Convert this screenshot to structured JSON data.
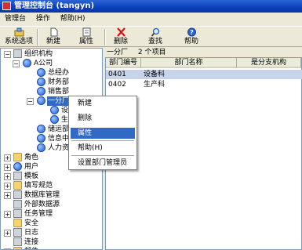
{
  "window": {
    "title": "管理控制台 (tangyn)"
  },
  "menubar": [
    "管理台",
    "操作",
    "帮助(H)"
  ],
  "toolbar": {
    "buttons": [
      {
        "label": "系统选项",
        "icon": "system-options-icon"
      },
      {
        "label": "新建",
        "icon": "new-document-icon"
      },
      {
        "label": "属性",
        "icon": "properties-icon"
      },
      {
        "label": "删除",
        "icon": "delete-x-icon"
      },
      {
        "label": "查找",
        "icon": "magnifier-icon"
      },
      {
        "label": "帮助",
        "icon": "help-icon"
      }
    ]
  },
  "tree": {
    "root": "组织机构",
    "company": "A公司",
    "departments": [
      "总经办",
      "财务部",
      "销售部",
      "一分厂",
      "设",
      "生",
      "储运部",
      "信息中",
      "人力资"
    ],
    "groups": [
      "角色",
      "用户",
      "模板",
      "填写规范",
      "数据库管理",
      "外部数据源",
      "任务管理",
      "安全",
      "日志",
      "连接",
      "邮件"
    ]
  },
  "list": {
    "location": "一分厂",
    "count_text": "2 个项目",
    "columns": [
      "部门编号",
      "部门名称",
      "是分支机构"
    ],
    "rows": [
      [
        "0401",
        "设备科",
        ""
      ],
      [
        "0402",
        "生产科",
        ""
      ]
    ]
  },
  "context_menu": {
    "items": [
      "新建",
      "删除",
      "属性",
      "帮助(H)",
      "设置部门管理员"
    ]
  }
}
